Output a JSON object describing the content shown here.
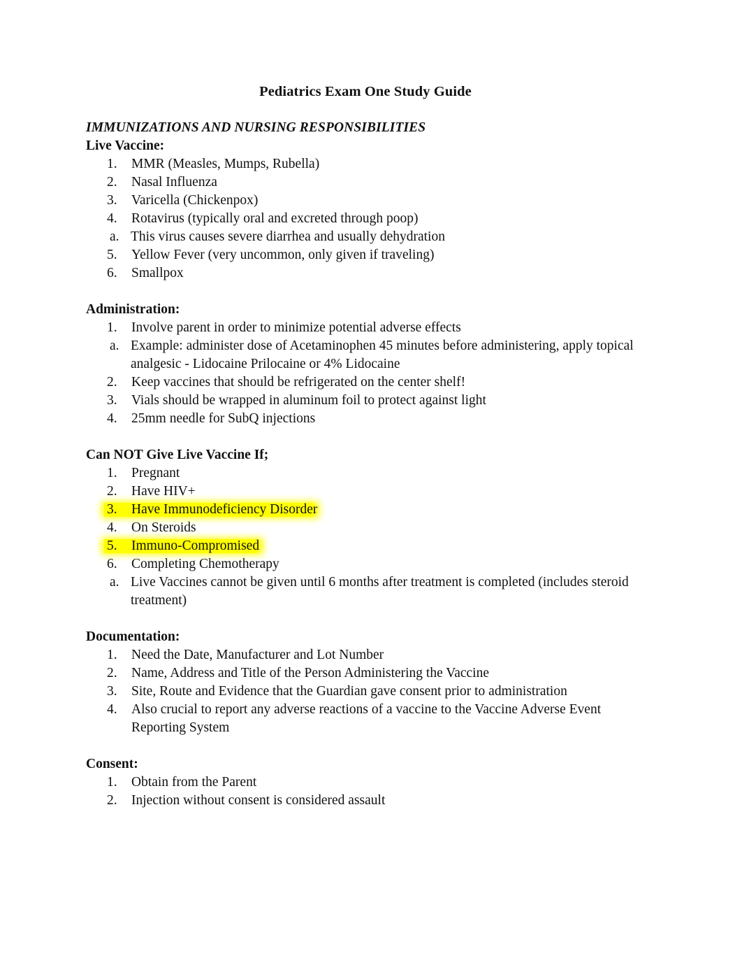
{
  "document": {
    "title": "Pediatrics Exam One Study Guide",
    "section_title": "IMMUNIZATIONS AND NURSING RESPONSIBILITIES"
  },
  "colors": {
    "highlight": "#FFFF00",
    "text": "#111111",
    "page_background": "#FFFFFF"
  },
  "sections": {
    "live_vaccine": {
      "heading": "Live Vaccine:",
      "items": [
        {
          "marker": "1.",
          "text": "MMR (Measles, Mumps, Rubella)"
        },
        {
          "marker": "2.",
          "text": "Nasal Influenza"
        },
        {
          "marker": "3.",
          "text": "Varicella (Chickenpox)"
        },
        {
          "marker": "4.",
          "text": "Rotavirus (typically oral and excreted through poop)"
        },
        {
          "marker": "a.",
          "text": "This virus causes severe diarrhea and usually dehydration"
        },
        {
          "marker": "5.",
          "text": "Yellow Fever (very uncommon, only given if traveling)"
        },
        {
          "marker": "6.",
          "text": "Smallpox"
        }
      ]
    },
    "administration": {
      "heading": "Administration:",
      "items": [
        {
          "marker": "1.",
          "text": "Involve parent in order to minimize potential adverse effects"
        },
        {
          "marker": "a.",
          "text": "Example: administer dose of Acetaminophen 45 minutes before administering, apply topical analgesic - Lidocaine Prilocaine or 4% Lidocaine"
        },
        {
          "marker": "2.",
          "text": "Keep vaccines that should be refrigerated on the center shelf!"
        },
        {
          "marker": "3.",
          "text": "Vials should be wrapped in aluminum foil to protect against light"
        },
        {
          "marker": "4.",
          "text": "25mm needle for SubQ injections"
        }
      ]
    },
    "cannot_give": {
      "heading": "Can NOT Give Live Vaccine If;",
      "items": [
        {
          "marker": "1.",
          "text": "Pregnant"
        },
        {
          "marker": "2.",
          "text": "Have HIV+"
        },
        {
          "marker": "3.",
          "text": "Have Immunodeficiency Disorder"
        },
        {
          "marker": "4.",
          "text": "On Steroids"
        },
        {
          "marker": "5.",
          "text": "Immuno-Compromised"
        },
        {
          "marker": "6.",
          "text": "Completing Chemotherapy"
        },
        {
          "marker": "a.",
          "text": "Live Vaccines cannot be given until 6 months after treatment is completed (includes steroid treatment)"
        }
      ]
    },
    "documentation": {
      "heading": "Documentation:",
      "items": [
        {
          "marker": "1.",
          "text": "Need the Date, Manufacturer and Lot Number"
        },
        {
          "marker": "2.",
          "text": "Name, Address and Title of the Person Administering the Vaccine"
        },
        {
          "marker": "3.",
          "text": "Site, Route and Evidence that the Guardian gave consent prior to administration"
        },
        {
          "marker": "4.",
          "text": "Also crucial to report any adverse reactions of a vaccine to the Vaccine Adverse Event Reporting System"
        }
      ]
    },
    "consent": {
      "heading": "Consent:",
      "items": [
        {
          "marker": "1.",
          "text": "Obtain from the Parent"
        },
        {
          "marker": "2.",
          "text": "Injection without consent is considered assault"
        }
      ]
    }
  },
  "highlights": [
    {
      "section": "cannot_give",
      "item_index": 2,
      "text": "Have Immunodeficiency Disorder",
      "color": "#FFFF00"
    },
    {
      "section": "cannot_give",
      "item_index": 4,
      "text": "Immuno-Compromised",
      "color": "#FFFF00"
    }
  ]
}
